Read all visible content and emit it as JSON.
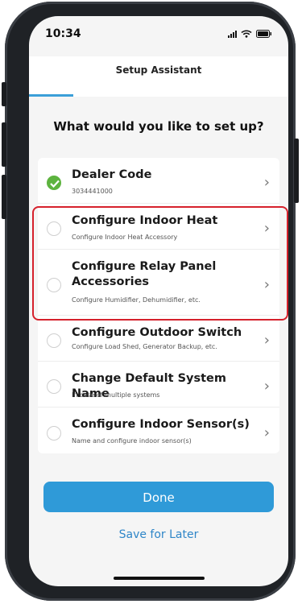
{
  "status_bar": {
    "time": "10:34"
  },
  "header": {
    "title": "Setup Assistant",
    "progress": 0.17
  },
  "question": "What would you like to set up?",
  "items": [
    {
      "title": "Dealer Code",
      "subtitle": "3034441000",
      "checked": true
    },
    {
      "title": "Configure Indoor Heat",
      "subtitle": "Configure Indoor Heat Accessory",
      "checked": false
    },
    {
      "title": "Configure Relay Panel Accessories",
      "subtitle": "Configure Humidifier, Dehumidifier, etc.",
      "checked": false
    },
    {
      "title": "Configure Outdoor Switch",
      "subtitle": "Configure Load Shed, Generator Backup, etc.",
      "checked": false
    },
    {
      "title": "Change Default System Name",
      "subtitle": "In case of multiple systems",
      "checked": false
    },
    {
      "title": "Configure Indoor Sensor(s)",
      "subtitle": "Name and configure indoor sensor(s)",
      "checked": false
    }
  ],
  "buttons": {
    "done": "Done",
    "save_later": "Save for Later"
  },
  "icons": {
    "check": "check-icon",
    "chevron": "chevron-right-icon",
    "signal": "signal-icon",
    "wifi": "wifi-icon",
    "battery": "battery-icon"
  },
  "colors": {
    "accent": "#2f9ad8",
    "check": "#5db33f",
    "highlight": "#d6212c"
  }
}
